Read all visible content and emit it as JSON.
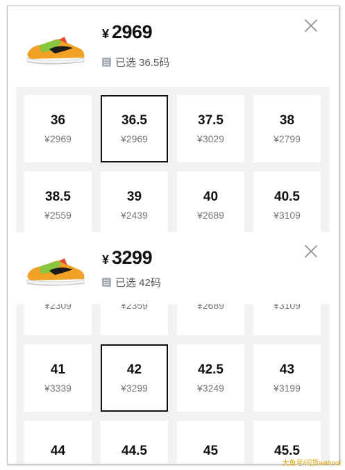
{
  "panel_1": {
    "currency": "¥",
    "price": "2969",
    "selected_text": "已选 36.5码",
    "sizes": [
      {
        "size": "36",
        "price": "¥2969",
        "selected": false
      },
      {
        "size": "36.5",
        "price": "¥2969",
        "selected": true
      },
      {
        "size": "37.5",
        "price": "¥3029",
        "selected": false
      },
      {
        "size": "38",
        "price": "¥2799",
        "selected": false
      },
      {
        "size": "38.5",
        "price": "¥2559",
        "selected": false
      },
      {
        "size": "39",
        "price": "¥2439",
        "selected": false
      },
      {
        "size": "40",
        "price": "¥2689",
        "selected": false
      },
      {
        "size": "40.5",
        "price": "¥3109",
        "selected": false
      }
    ]
  },
  "panel_2": {
    "currency": "¥",
    "price": "3299",
    "selected_text": "已选 42码",
    "sizes": [
      {
        "size": "",
        "price": "¥2309",
        "selected": false
      },
      {
        "size": "",
        "price": "¥2359",
        "selected": false
      },
      {
        "size": "",
        "price": "¥2689",
        "selected": false
      },
      {
        "size": "",
        "price": "¥3109",
        "selected": false
      },
      {
        "size": "41",
        "price": "¥3339",
        "selected": false
      },
      {
        "size": "42",
        "price": "¥3299",
        "selected": true
      },
      {
        "size": "42.5",
        "price": "¥3249",
        "selected": false
      },
      {
        "size": "43",
        "price": "¥3199",
        "selected": false
      },
      {
        "size": "44",
        "price": "",
        "selected": false
      },
      {
        "size": "44.5",
        "price": "",
        "selected": false
      },
      {
        "size": "45",
        "price": "",
        "selected": false
      },
      {
        "size": "45.5",
        "price": "",
        "selected": false
      }
    ]
  },
  "watermark": "大鱼号/闪货wahool",
  "icons": {
    "close": "close-icon",
    "tag": "tag-icon",
    "product": "sneaker-image"
  },
  "colors": {
    "selected_border": "#111111",
    "grid_background": "#f2f2f5",
    "price_text": "#777777"
  }
}
